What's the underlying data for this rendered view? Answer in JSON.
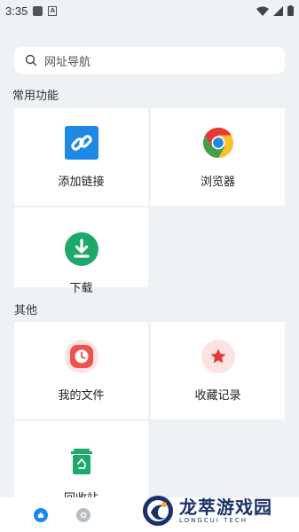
{
  "status_bar": {
    "time": "3:35"
  },
  "search": {
    "placeholder": "网址导航"
  },
  "sections": [
    {
      "title": "常用功能",
      "items": [
        {
          "label": "添加链接",
          "icon": "link-icon",
          "color": "#1e88e5"
        },
        {
          "label": "浏览器",
          "icon": "chrome-icon",
          "color": "#e53935"
        },
        {
          "label": "下载",
          "icon": "download-icon",
          "color": "#1ea86a"
        }
      ]
    },
    {
      "title": "其他",
      "items": [
        {
          "label": "我的文件",
          "icon": "clock-icon",
          "color": "#ef5350"
        },
        {
          "label": "收藏记录",
          "icon": "star-icon",
          "color": "#e53935"
        },
        {
          "label": "回收站",
          "icon": "recycle-bin-icon",
          "color": "#1ea86a"
        }
      ]
    }
  ],
  "watermark": {
    "title": "龙萃游戏园",
    "subtitle": "LONGCUI TECH"
  },
  "colors": {
    "background": "#eef2f4",
    "accent_blue": "#1e88e5",
    "accent_green": "#1ea86a",
    "accent_red": "#e53935"
  }
}
